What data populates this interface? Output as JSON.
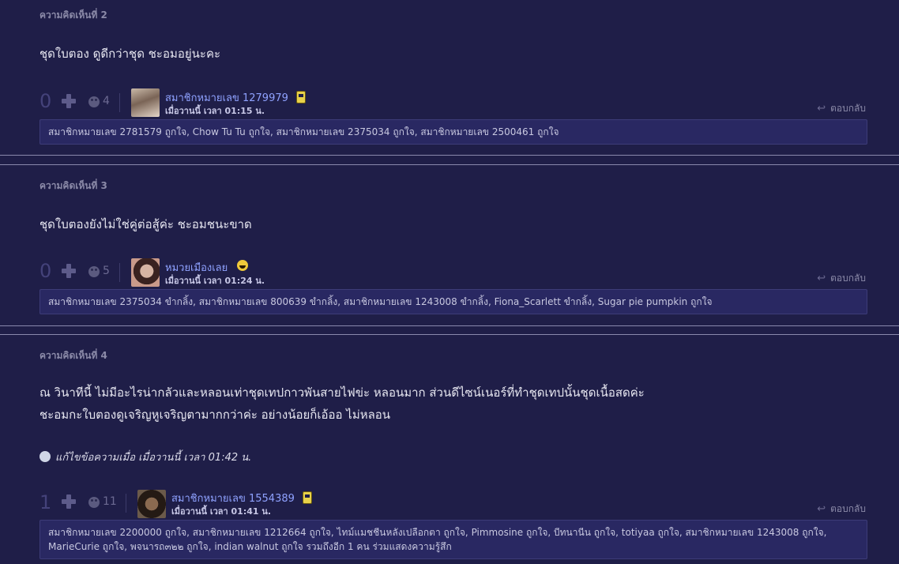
{
  "comments": [
    {
      "label": "ความคิดเห็นที่ 2",
      "body": [
        "ชุดใบตอง ดูดีกว่าชุด ชะอมอยู่นะคะ"
      ],
      "votes": "0",
      "emotion_count": "4",
      "username": "สมาชิกหมายเลข 1279979",
      "timestamp": "เมื่อวานนี้ เวลา 01:15 น.",
      "reply": "ตอบกลับ",
      "likes": "สมาชิกหมายเลข 2781579 ถูกใจ, Chow Tu Tu ถูกใจ, สมาชิกหมายเลข 2375034 ถูกใจ, สมาชิกหมายเลข 2500461 ถูกใจ"
    },
    {
      "label": "ความคิดเห็นที่ 3",
      "body": [
        "ชุดใบตองยังไม่ใช่คู่ต่อสู้ค่ะ ชะอมชนะขาด"
      ],
      "votes": "0",
      "emotion_count": "5",
      "username": "หมวยเมืองเลย",
      "timestamp": "เมื่อวานนี้ เวลา 01:24 น.",
      "reply": "ตอบกลับ",
      "likes": "สมาชิกหมายเลข 2375034 ขำกลิ้ง, สมาชิกหมายเลข 800639 ขำกลิ้ง, สมาชิกหมายเลข 1243008 ขำกลิ้ง, Fiona_Scarlett ขำกลิ้ง, Sugar pie pumpkin ถูกใจ"
    },
    {
      "label": "ความคิดเห็นที่ 4",
      "body": [
        "ณ วินาทีนี้ ไม่มีอะไรน่ากลัวและหลอนเท่าชุดเทปกาวพันสายไฟข่ะ หลอนมาก ส่วนดีไซน์เนอร์ที่ทำชุดเทปนั้นชุดเนื้อสดค่ะ",
        "ชะอมกะใบตองดูเจริญหูเจริญตามากกว่าค่ะ อย่างน้อยก็เอ้ออ ไม่หลอน"
      ],
      "edit_note": "แก้ไขข้อความเมื่อ เมื่อวานนี้ เวลา 01:42 น.",
      "votes": "1",
      "emotion_count": "11",
      "username": "สมาชิกหมายเลข 1554389",
      "timestamp": "เมื่อวานนี้ เวลา 01:41 น.",
      "reply": "ตอบกลับ",
      "likes": "สมาชิกหมายเลข 2200000 ถูกใจ, สมาชิกหมายเลข 1212664 ถูกใจ, ไทม์แมชชีนหลังเปลือกตา ถูกใจ, Pimmosine ถูกใจ, บีทนานีน ถูกใจ, totiyaa ถูกใจ, สมาชิกหมายเลข 1243008 ถูกใจ, MarieCurie ถูกใจ, พจนารถ๓๒๒ ถูกใจ, indian walnut ถูกใจ รวมถึงอีก 1 คน ร่วมแสดงความรู้สึก"
    }
  ],
  "colors": {
    "background": "#1f1e48",
    "likes_box": "#292862",
    "username": "#8fa2ff"
  }
}
